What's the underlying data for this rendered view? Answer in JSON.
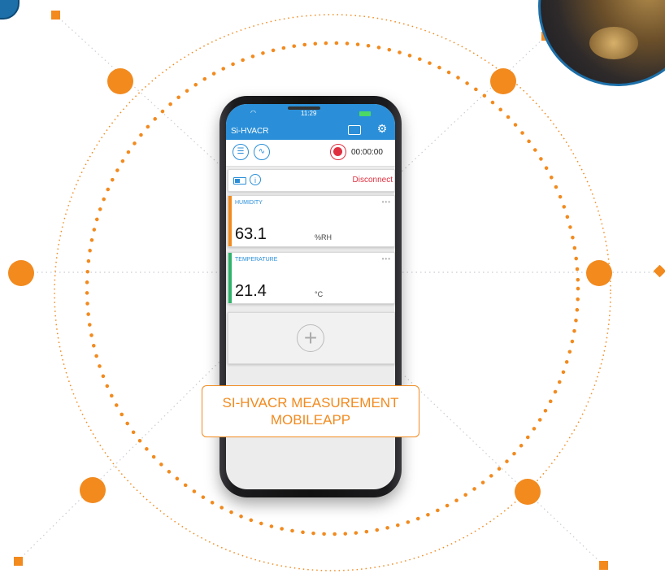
{
  "colors": {
    "accent_orange": "#f28a1e",
    "app_blue": "#2a8fd8",
    "record_red": "#e03040",
    "humidity_strip": "#f28a1e",
    "temperature_strip": "#2fb36a"
  },
  "phone": {
    "status_time": "11:29",
    "app_title": "Si-HVACR",
    "icons": {
      "list": "list-icon",
      "wave": "wave-icon",
      "record": "record-icon",
      "card": "card-icon",
      "settings": "gear-icon",
      "battery": "battery-icon",
      "info": "info-icon",
      "add": "add-icon"
    },
    "timer": "00:00:00",
    "device_info_label": "i",
    "disconnect": "Disconnect",
    "cards": [
      {
        "label": "HUMIDITY",
        "value": "63.1",
        "unit": "%RH",
        "menu": "•••"
      },
      {
        "label": "TEMPERATURE",
        "value": "21.4",
        "unit": "°C",
        "menu": "•••"
      }
    ],
    "add_symbol": "+"
  },
  "callout": {
    "line1": "SI-HVACR MEASUREMENT",
    "line2": "MOBILEAPP"
  }
}
